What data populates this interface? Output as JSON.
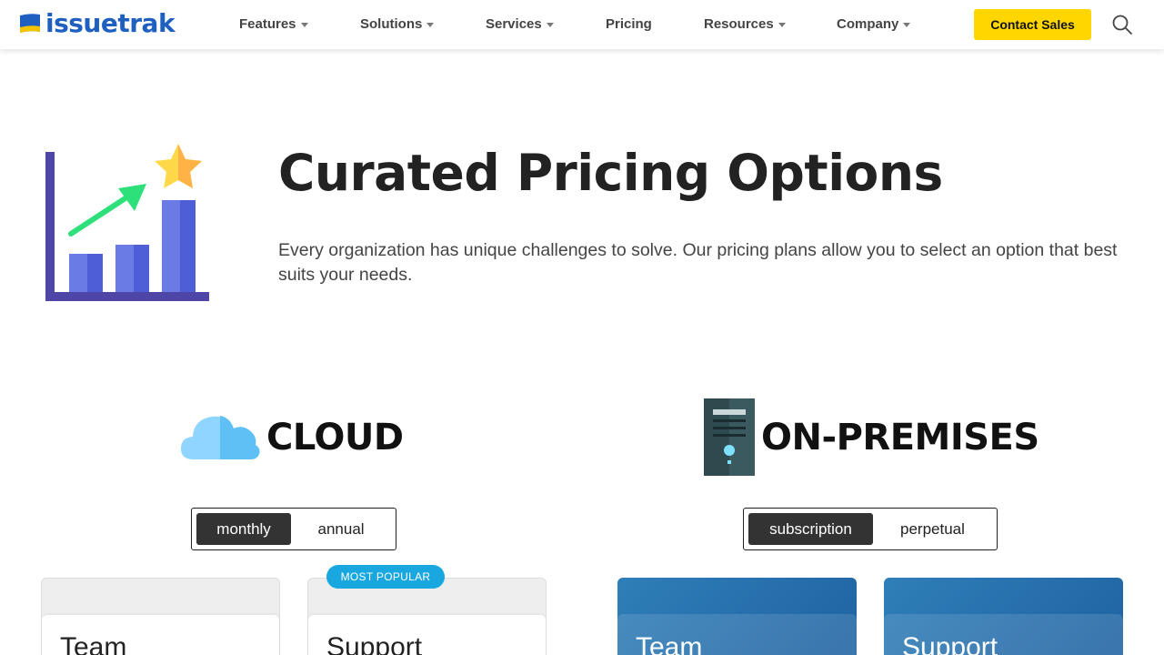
{
  "brand": {
    "name": "issuetrak"
  },
  "nav": {
    "items": [
      {
        "label": "Features",
        "dropdown": true
      },
      {
        "label": "Solutions",
        "dropdown": true
      },
      {
        "label": "Services",
        "dropdown": true
      },
      {
        "label": "Pricing",
        "dropdown": false
      },
      {
        "label": "Resources",
        "dropdown": true
      },
      {
        "label": "Company",
        "dropdown": true
      }
    ],
    "cta": "Contact Sales",
    "search_icon": "search-icon"
  },
  "hero": {
    "title": "Curated Pricing Options",
    "description": "Every organization has unique challenges to solve. Our pricing plans allow you to select an option that best suits your needs.",
    "icon": "growth-chart-icon"
  },
  "cloud": {
    "title": "CLOUD",
    "icon": "cloud-icon",
    "toggle": {
      "options": [
        "monthly",
        "annual"
      ],
      "selected": "monthly"
    },
    "cards": [
      {
        "name": "Team"
      },
      {
        "name": "Support",
        "badge": "MOST POPULAR"
      }
    ]
  },
  "onprem": {
    "title": "ON-PREMISES",
    "icon": "server-icon",
    "toggle": {
      "options": [
        "subscription",
        "perpetual"
      ],
      "selected": "subscription"
    },
    "cards": [
      {
        "name": "Team"
      },
      {
        "name": "Support"
      }
    ]
  },
  "colors": {
    "accent_yellow": "#ffd600",
    "brand_blue": "#1f5fbf",
    "badge_blue": "#19a7e0",
    "card_blue": "#2f7fb8"
  }
}
